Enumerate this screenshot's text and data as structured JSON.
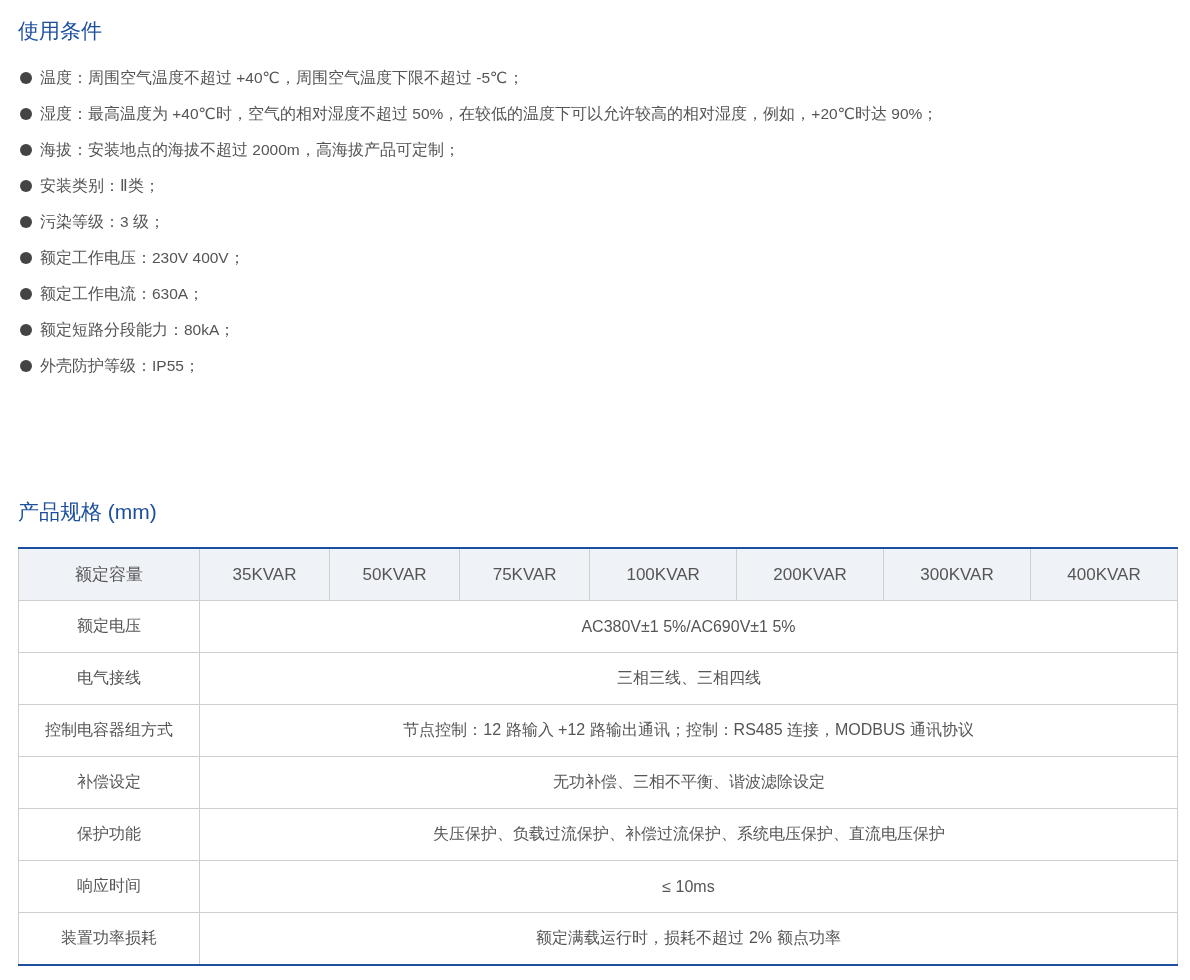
{
  "conditions": {
    "title": "使用条件",
    "items": [
      "温度：周围空气温度不超过 +40℃，周围空气温度下限不超过 -5℃；",
      "湿度：最高温度为 +40℃时，空气的相对湿度不超过 50%，在较低的温度下可以允许较高的相对湿度，例如，+20℃时达 90%；",
      "海拔：安装地点的海拔不超过 2000m，高海拔产品可定制；",
      "安装类别：Ⅱ类；",
      "污染等级：3 级；",
      "额定工作电压：230V  400V；",
      "额定工作电流：630A；",
      "额定短路分段能力：80kA；",
      "外壳防护等级：IP55；"
    ]
  },
  "specs": {
    "title": "产品规格 (mm)",
    "table": {
      "columns": [
        "额定容量",
        "35KVAR",
        "50KVAR",
        "75KVAR",
        "100KVAR",
        "200KVAR",
        "300KVAR",
        "400KVAR"
      ],
      "rows": [
        {
          "label": "额定电压",
          "value": "AC380V±1 5%/AC690V±1 5%"
        },
        {
          "label": "电气接线",
          "value": "三相三线、三相四线"
        },
        {
          "label": "控制电容器组方式",
          "value": "节点控制：12 路输入 +12 路输出通讯；控制：RS485 连接，MODBUS 通讯协议"
        },
        {
          "label": "补偿设定",
          "value": "无功补偿、三相不平衡、谐波滤除设定"
        },
        {
          "label": "保护功能",
          "value": "失压保护、负载过流保护、补偿过流保护、系统电压保护、直流电压保护"
        },
        {
          "label": "响应时间",
          "value": "≤ 10ms"
        },
        {
          "label": "装置功率损耗",
          "value": "额定满载运行时，损耗不超过 2% 额点功率"
        }
      ]
    }
  }
}
